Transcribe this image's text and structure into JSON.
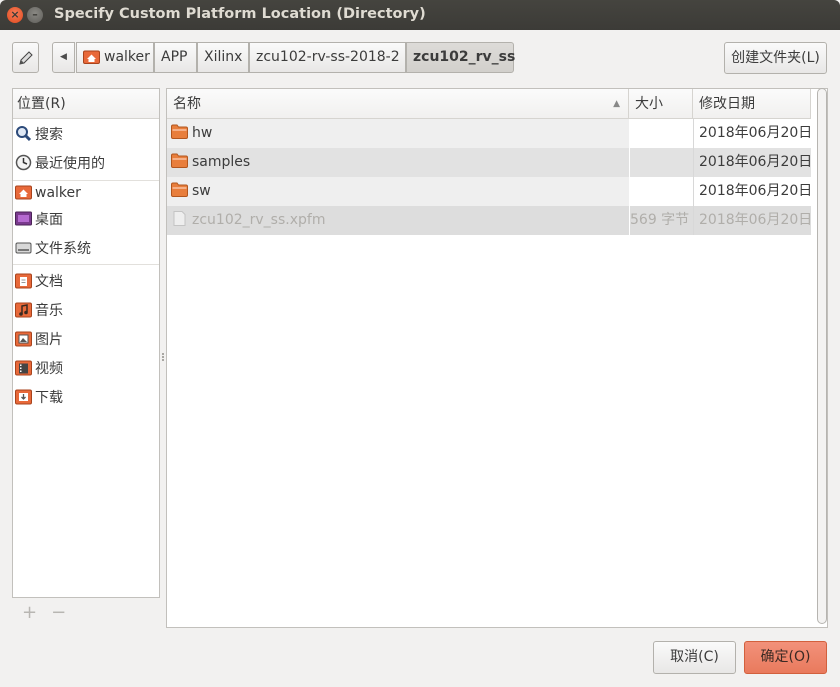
{
  "window": {
    "title": "Specify Custom Platform Location (Directory)"
  },
  "toolbar": {
    "breadcrumbs": [
      "walker",
      "APP",
      "Xilinx",
      "zcu102-rv-ss-2018-2",
      "zcu102_rv_ss"
    ],
    "new_folder_label": "创建文件夹(L)"
  },
  "sidebar": {
    "header": "位置(R)",
    "items": [
      {
        "label": "搜索",
        "icon": "search-icon"
      },
      {
        "label": "最近使用的",
        "icon": "recent-icon"
      },
      {
        "label": "walker",
        "icon": "home-folder-icon"
      },
      {
        "label": "桌面",
        "icon": "desktop-icon"
      },
      {
        "label": "文件系统",
        "icon": "drive-icon"
      },
      {
        "label": "文档",
        "icon": "documents-icon"
      },
      {
        "label": "音乐",
        "icon": "music-icon"
      },
      {
        "label": "图片",
        "icon": "pictures-icon"
      },
      {
        "label": "视频",
        "icon": "videos-icon"
      },
      {
        "label": "下载",
        "icon": "downloads-icon"
      }
    ],
    "add_label": "+",
    "remove_label": "−"
  },
  "filelist": {
    "columns": {
      "name": "名称",
      "size": "大小",
      "modified": "修改日期"
    },
    "rows": [
      {
        "name": "hw",
        "size": "",
        "modified": "2018年06月20日",
        "type": "folder"
      },
      {
        "name": "samples",
        "size": "",
        "modified": "2018年06月20日",
        "type": "folder"
      },
      {
        "name": "sw",
        "size": "",
        "modified": "2018年06月20日",
        "type": "folder"
      },
      {
        "name": "zcu102_rv_ss.xpfm",
        "size": "569 字节",
        "modified": "2018年06月20日",
        "type": "file"
      }
    ]
  },
  "buttons": {
    "cancel": "取消(C)",
    "ok": "确定(O)"
  },
  "colors": {
    "titlebar": "#3c3b37",
    "accent_ok": "#e97a5d",
    "folder": "#e87e3c"
  }
}
